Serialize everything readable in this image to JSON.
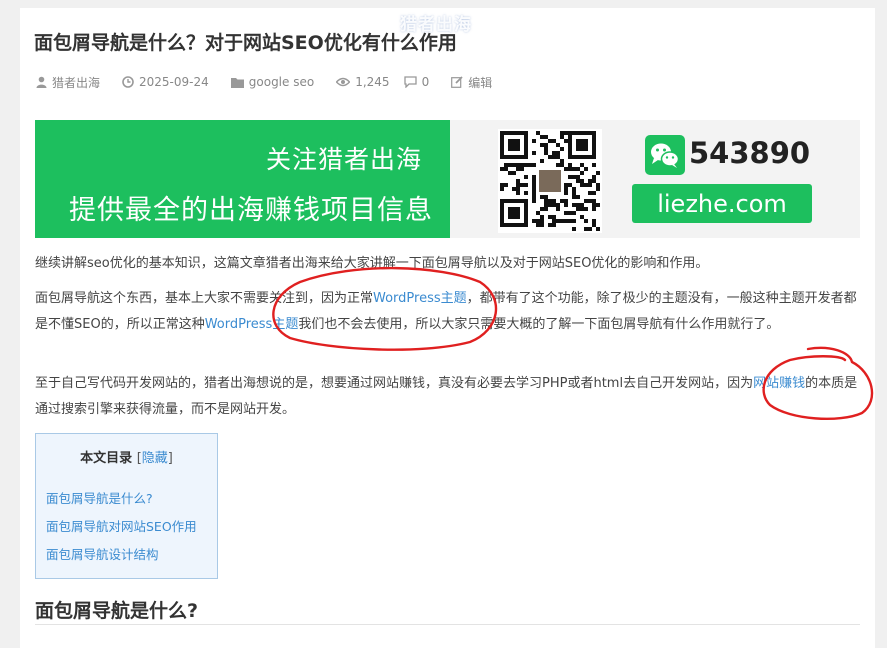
{
  "watermark": "猎者出海",
  "article": {
    "title": "面包屑导航是什么？对于网站SEO优化有什么作用"
  },
  "meta": {
    "author": "猎者出海",
    "date": "2025-09-24",
    "category": "google seo",
    "views": "1,245",
    "comments": "0",
    "edit": "编辑"
  },
  "banner": {
    "line1": "关注猎者出海",
    "line2": "提供最全的出海赚钱项目信息",
    "wechat_id": "543890",
    "site": "liezhe.com",
    "brand_color": "#1dbf5e"
  },
  "content": {
    "p1": "继续讲解seo优化的基本知识，这篇文章猎者出海来给大家讲解一下面包屑导航以及对于网站SEO优化的影响和作用。",
    "p2_a": "面包屑导航这个东西，基本上大家不需要关注到，因为正常",
    "p2_link1": "WordPress主题",
    "p2_b": "，都带有了这个功能，除了极少的主题没有，一般这种主题开发者都是不懂SEO的，所以正常这种",
    "p2_link2": "WordPress主题",
    "p2_c": "我们也不会去使用，所以大家只需要大概的了解一下面包屑导航有什么作用就行了。",
    "p3_a": "至于自己写代码开发网站的，猎者出海想说的是，想要通过网站赚钱，真没有必要去学习PHP或者html去自己开发网站，因为",
    "p3_link": "网站赚钱",
    "p3_b": "的本质是通过搜索引擎来获得流量，而不是网站开发。"
  },
  "toc": {
    "title": "本文目录",
    "bracket_open": "[",
    "toggle": "隐藏",
    "bracket_close": "]",
    "items": [
      "面包屑导航是什么?",
      "面包屑导航对网站SEO作用",
      "面包屑导航设计结构"
    ]
  },
  "section_heading": "面包屑导航是什么?",
  "colors": {
    "link": "#3b8bd0",
    "annotation": "#e02020",
    "toc_bg": "#eef5fd"
  },
  "icons": [
    "user-icon",
    "clock-icon",
    "folder-icon",
    "eye-icon",
    "comment-icon",
    "edit-icon",
    "wechat-icon",
    "qr-code"
  ]
}
